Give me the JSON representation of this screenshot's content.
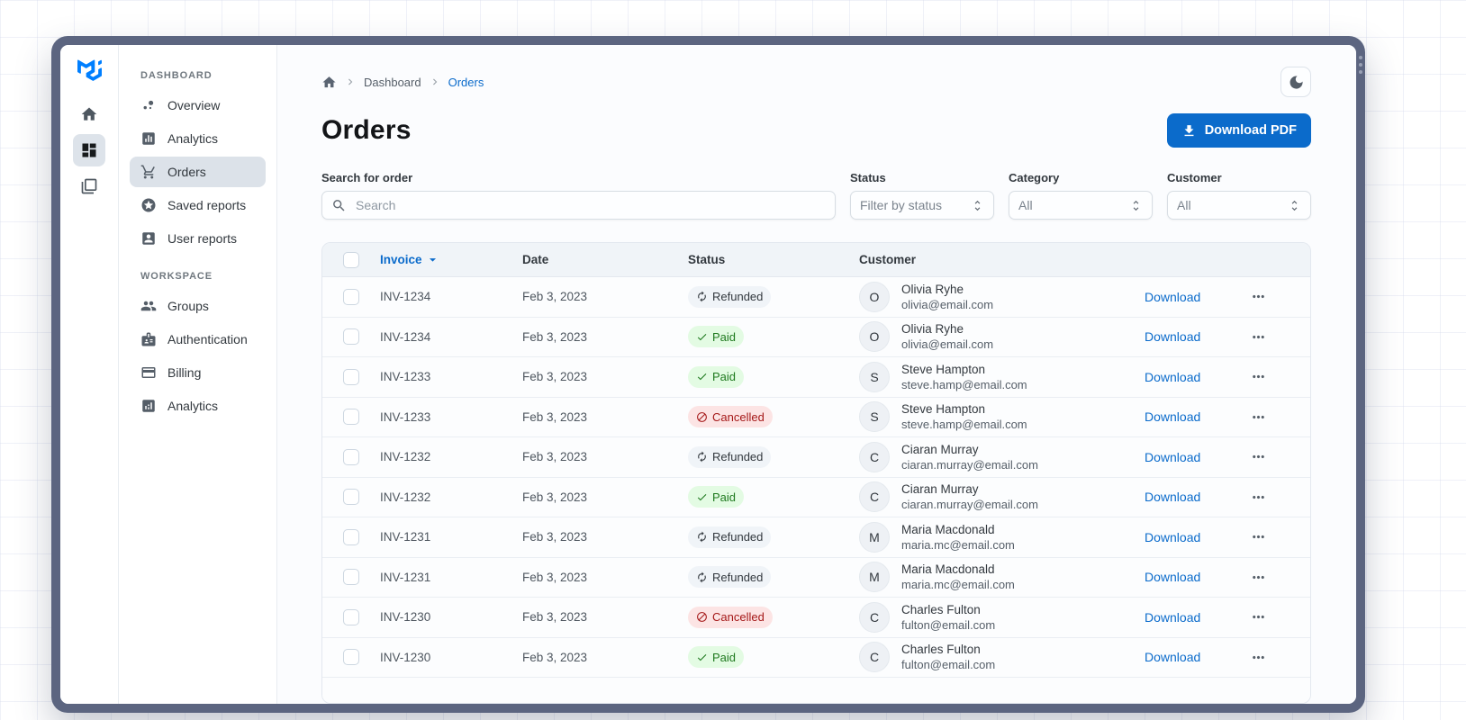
{
  "sidebar": {
    "rail": [
      {
        "icon": "home",
        "name": "home",
        "selected": false
      },
      {
        "icon": "dashboard",
        "name": "dashboard",
        "selected": true
      },
      {
        "icon": "stack",
        "name": "pages",
        "selected": false
      }
    ],
    "sections": [
      {
        "label": "DASHBOARD",
        "items": [
          {
            "icon": "bubble-chart",
            "label": "Overview",
            "selected": false
          },
          {
            "icon": "bar-chart",
            "label": "Analytics",
            "selected": false
          },
          {
            "icon": "cart",
            "label": "Orders",
            "selected": true
          },
          {
            "icon": "star",
            "label": "Saved reports",
            "selected": false
          },
          {
            "icon": "person-card",
            "label": "User reports",
            "selected": false
          }
        ]
      },
      {
        "label": "WORKSPACE",
        "items": [
          {
            "icon": "groups",
            "label": "Groups",
            "selected": false
          },
          {
            "icon": "badge",
            "label": "Authentication",
            "selected": false
          },
          {
            "icon": "credit-card",
            "label": "Billing",
            "selected": false
          },
          {
            "icon": "chart-square",
            "label": "Analytics",
            "selected": false
          }
        ]
      }
    ]
  },
  "breadcrumb": {
    "items": [
      "Dashboard",
      "Orders"
    ]
  },
  "header": {
    "title": "Orders",
    "download_button": "Download PDF"
  },
  "filters": {
    "search": {
      "label": "Search for order",
      "placeholder": "Search"
    },
    "status": {
      "label": "Status",
      "value": "Filter by status"
    },
    "category": {
      "label": "Category",
      "value": "All"
    },
    "customer": {
      "label": "Customer",
      "value": "All"
    }
  },
  "table": {
    "columns": [
      "Invoice",
      "Date",
      "Status",
      "Customer"
    ],
    "sorted_by": "Invoice",
    "row_action": "Download",
    "rows": [
      {
        "invoice": "INV-1234",
        "date": "Feb 3, 2023",
        "status": {
          "label": "Refunded",
          "type": "neutral"
        },
        "customer": {
          "initial": "O",
          "name": "Olivia Ryhe",
          "email": "olivia@email.com"
        }
      },
      {
        "invoice": "INV-1234",
        "date": "Feb 3, 2023",
        "status": {
          "label": "Paid",
          "type": "success"
        },
        "customer": {
          "initial": "O",
          "name": "Olivia Ryhe",
          "email": "olivia@email.com"
        }
      },
      {
        "invoice": "INV-1233",
        "date": "Feb 3, 2023",
        "status": {
          "label": "Paid",
          "type": "success"
        },
        "customer": {
          "initial": "S",
          "name": "Steve Hampton",
          "email": "steve.hamp@email.com"
        }
      },
      {
        "invoice": "INV-1233",
        "date": "Feb 3, 2023",
        "status": {
          "label": "Cancelled",
          "type": "danger"
        },
        "customer": {
          "initial": "S",
          "name": "Steve Hampton",
          "email": "steve.hamp@email.com"
        }
      },
      {
        "invoice": "INV-1232",
        "date": "Feb 3, 2023",
        "status": {
          "label": "Refunded",
          "type": "neutral"
        },
        "customer": {
          "initial": "C",
          "name": "Ciaran Murray",
          "email": "ciaran.murray@email.com"
        }
      },
      {
        "invoice": "INV-1232",
        "date": "Feb 3, 2023",
        "status": {
          "label": "Paid",
          "type": "success"
        },
        "customer": {
          "initial": "C",
          "name": "Ciaran Murray",
          "email": "ciaran.murray@email.com"
        }
      },
      {
        "invoice": "INV-1231",
        "date": "Feb 3, 2023",
        "status": {
          "label": "Refunded",
          "type": "neutral"
        },
        "customer": {
          "initial": "M",
          "name": "Maria Macdonald",
          "email": "maria.mc@email.com"
        }
      },
      {
        "invoice": "INV-1231",
        "date": "Feb 3, 2023",
        "status": {
          "label": "Refunded",
          "type": "neutral"
        },
        "customer": {
          "initial": "M",
          "name": "Maria Macdonald",
          "email": "maria.mc@email.com"
        }
      },
      {
        "invoice": "INV-1230",
        "date": "Feb 3, 2023",
        "status": {
          "label": "Cancelled",
          "type": "danger"
        },
        "customer": {
          "initial": "C",
          "name": "Charles Fulton",
          "email": "fulton@email.com"
        }
      },
      {
        "invoice": "INV-1230",
        "date": "Feb 3, 2023",
        "status": {
          "label": "Paid",
          "type": "success"
        },
        "customer": {
          "initial": "C",
          "name": "Charles Fulton",
          "email": "fulton@email.com"
        }
      }
    ]
  },
  "colors": {
    "primary": "#0B6BCB",
    "logo_blue": "#007FFF",
    "frame": "#5C6580",
    "success_bg": "#E3FBE3",
    "success_text": "#1F7A1F",
    "danger_bg": "#FCE4E4",
    "danger_text": "#A51818",
    "neutral_bg": "#F0F4F8",
    "neutral_text": "#32383E"
  }
}
